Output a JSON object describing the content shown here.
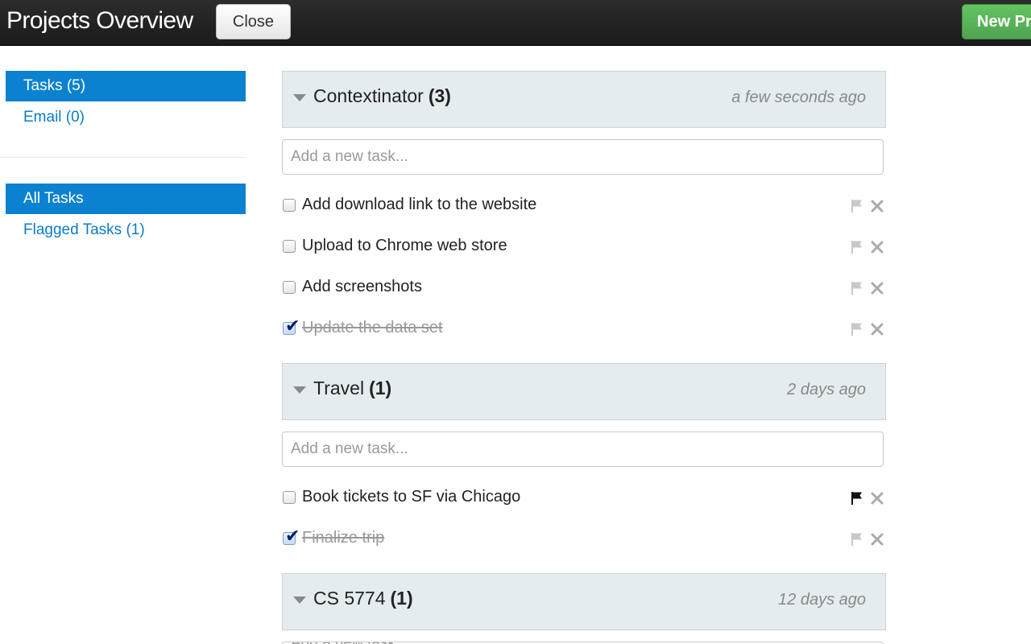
{
  "header": {
    "title": "Projects Overview",
    "close_label": "Close",
    "new_label": "New Pr"
  },
  "sidebar": {
    "section1": [
      {
        "label": "Tasks (5)",
        "active": true
      },
      {
        "label": "Email (0)",
        "active": false
      }
    ],
    "section2": [
      {
        "label": "All Tasks",
        "active": true
      },
      {
        "label": "Flagged Tasks (1)",
        "active": false
      }
    ]
  },
  "task_input_placeholder": "Add a new task...",
  "projects": [
    {
      "name": "Contextinator",
      "count": "(3)",
      "time": "a few seconds ago",
      "tasks": [
        {
          "text": "Add download link to the website",
          "done": false,
          "flagged": false
        },
        {
          "text": "Upload to Chrome web store",
          "done": false,
          "flagged": false
        },
        {
          "text": "Add screenshots",
          "done": false,
          "flagged": false
        },
        {
          "text": "Update the data set",
          "done": true,
          "flagged": false
        }
      ]
    },
    {
      "name": "Travel",
      "count": "(1)",
      "time": "2 days ago",
      "tasks": [
        {
          "text": "Book tickets to SF via Chicago",
          "done": false,
          "flagged": true
        },
        {
          "text": "Finalize trip",
          "done": true,
          "flagged": false
        }
      ]
    },
    {
      "name": "CS 5774",
      "count": "(1)",
      "time": "12 days ago",
      "tasks": []
    }
  ],
  "colors": {
    "accent": "#0a82cf",
    "link": "#0a7cc7",
    "header_bar": "#1b1b1b",
    "success": "#51a351",
    "project_header_bg": "#e5ecef"
  }
}
